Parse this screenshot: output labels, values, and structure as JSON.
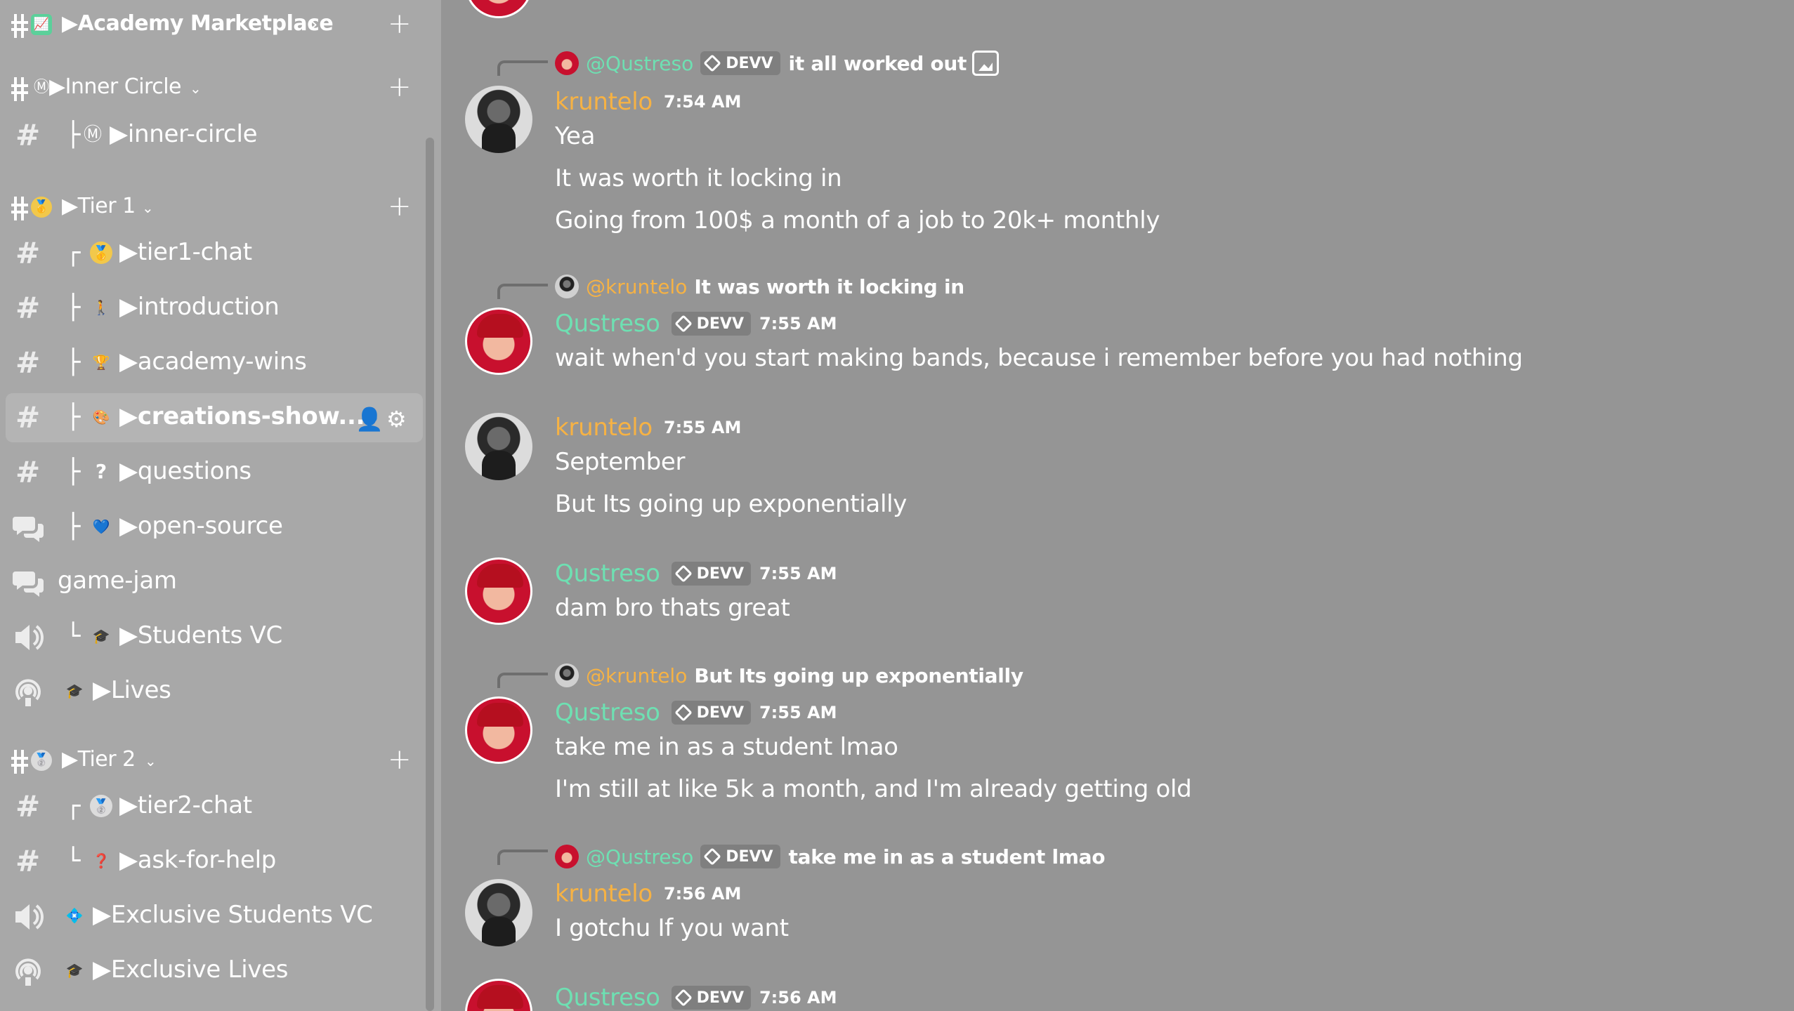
{
  "sidebar": {
    "categories": {
      "academy_marketplace": {
        "label": "▶Academy Marketplace",
        "emoji": "📈"
      },
      "inner_circle": {
        "label": "▶Inner Circle",
        "emoji": "Ⓜ"
      },
      "tier1": {
        "label": "▶Tier 1",
        "emoji": "🥇"
      },
      "tier2": {
        "label": "▶Tier 2",
        "emoji": "🥈"
      }
    },
    "channels": {
      "inner_circle": {
        "tree": "├",
        "emoji": "Ⓜ",
        "label": "▶inner-circle"
      },
      "tier1_chat": {
        "tree": "┌",
        "emoji": "🥇",
        "label": "▶tier1-chat"
      },
      "introduction": {
        "tree": "├",
        "emoji": "🚶",
        "label": "▶introduction"
      },
      "academy_wins": {
        "tree": "├",
        "emoji": "🏆",
        "label": "▶academy-wins"
      },
      "creations_show": {
        "tree": "├",
        "emoji": "🎨",
        "label": "▶creations-show..."
      },
      "questions": {
        "tree": "├",
        "emoji": "?",
        "label": "▶questions"
      },
      "open_source": {
        "tree": "├",
        "emoji": "💙",
        "label": "▶open-source"
      },
      "game_jam": {
        "label": "game-jam"
      },
      "students_vc": {
        "tree": "└",
        "emoji": "🎓",
        "label": "▶Students VC"
      },
      "lives": {
        "emoji": "🎓",
        "label": "▶Lives"
      },
      "tier2_chat": {
        "tree": "┌",
        "emoji": "🥈",
        "label": "▶tier2-chat"
      },
      "ask_for_help": {
        "tree": "└",
        "emoji": "❓",
        "label": "▶ask-for-help"
      },
      "exclusive_students_vc": {
        "emoji": "💠",
        "label": "▶Exclusive Students VC"
      },
      "exclusive_lives": {
        "emoji": "🎓",
        "label": "▶Exclusive Lives"
      }
    },
    "icons": {
      "hash": "#",
      "add": "+",
      "chevron": "⌄",
      "add_member": "👤",
      "settings": "⚙"
    }
  },
  "chat": {
    "badge_label": "DEVV",
    "colors": {
      "kruntelo": "#f6b244",
      "qustreso": "#6ee0b2"
    },
    "messages": [
      {
        "reply": {
          "name": "@Qustreso",
          "badge": true,
          "text": "it all worked out"
        },
        "author": "kruntelo",
        "time": "7:54 AM",
        "lines": [
          "Yea",
          "It was worth it locking in",
          "Going from 100$ a month of a job to 20k+ monthly"
        ]
      },
      {
        "reply": {
          "name": "@kruntelo",
          "text": "It was worth it locking in"
        },
        "author": "Qustreso",
        "badge": true,
        "time": "7:55 AM",
        "lines": [
          "wait when'd you start making bands, because i remember before you had nothing"
        ]
      },
      {
        "author": "kruntelo",
        "time": "7:55 AM",
        "lines": [
          "September",
          "But Its going up exponentially"
        ]
      },
      {
        "author": "Qustreso",
        "badge": true,
        "time": "7:55 AM",
        "lines": [
          "dam bro thats great"
        ]
      },
      {
        "reply": {
          "name": "@kruntelo",
          "text": "But Its going up exponentially"
        },
        "author": "Qustreso",
        "badge": true,
        "time": "7:55 AM",
        "lines": [
          "take me in as a student lmao",
          "I'm still at like 5k a month, and I'm already getting old"
        ]
      },
      {
        "reply": {
          "name": "@Qustreso",
          "badge": true,
          "text": "take me in as a student lmao"
        },
        "author": "kruntelo",
        "time": "7:56 AM",
        "lines": [
          "I gotchu If you want"
        ]
      },
      {
        "author": "Qustreso",
        "badge": true,
        "time": "7:56 AM",
        "lines": []
      }
    ]
  }
}
